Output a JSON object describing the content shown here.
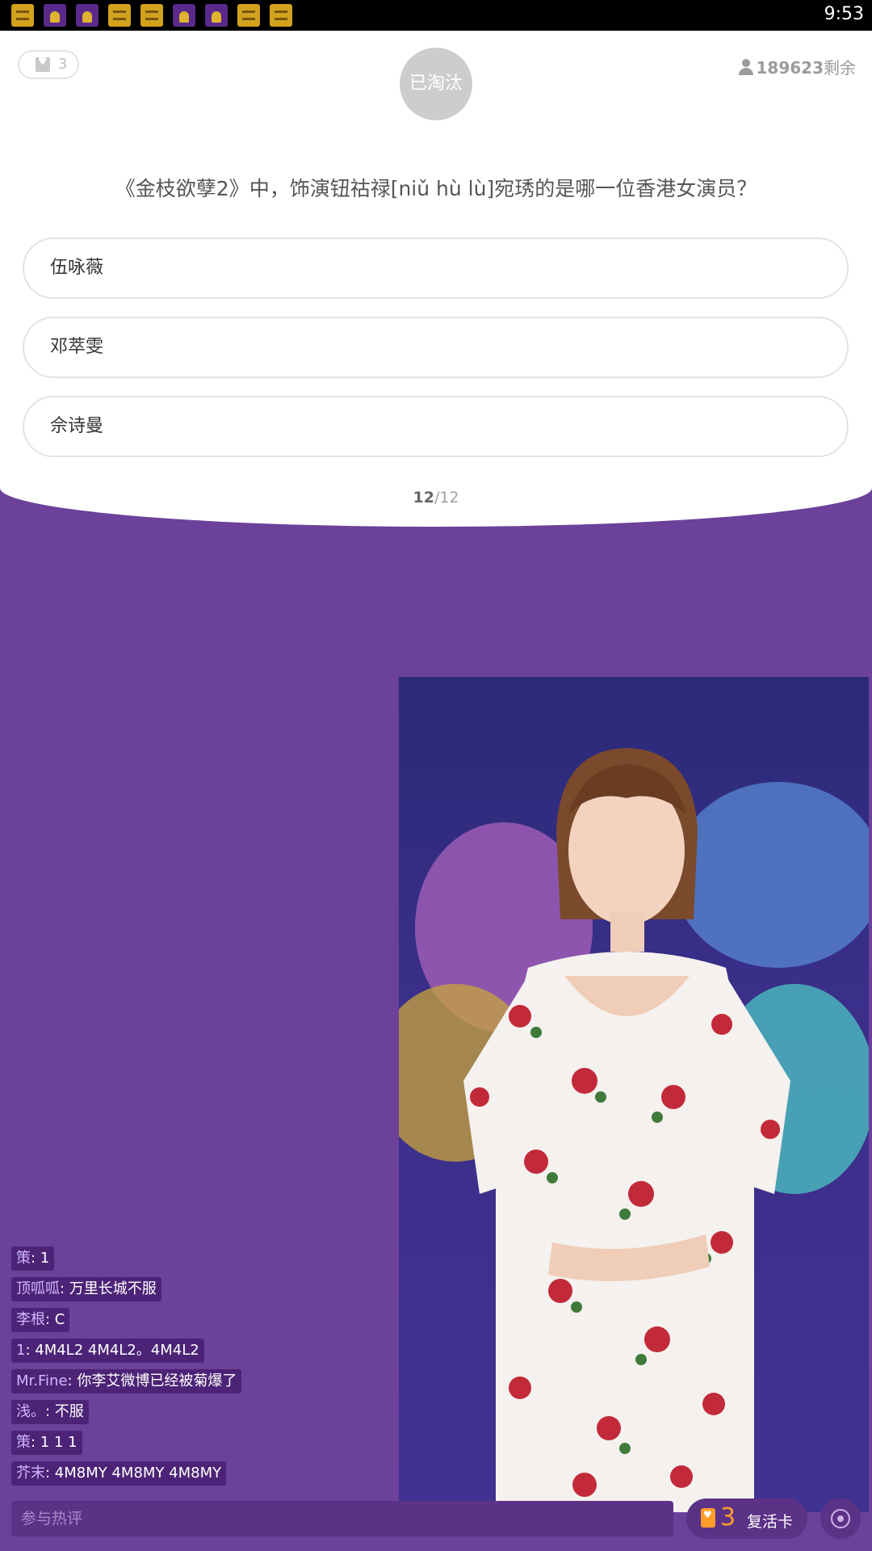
{
  "status_bar": {
    "time": "9:53",
    "notification_icons": [
      "gold-app-icon",
      "purple-app-icon",
      "purple-app-icon",
      "gold-app-icon",
      "gold-app-icon",
      "purple-app-icon",
      "purple-app-icon",
      "gold-app-icon",
      "gold-app-icon"
    ]
  },
  "header": {
    "lives_count": "3",
    "eliminated_label": "已淘汰",
    "remaining_count": "189623",
    "remaining_suffix": "剩余"
  },
  "question": {
    "text": "《金枝欲孽2》中，饰演钮祜禄[niǔ hù lù]宛琇的是哪一位香港女演员？",
    "options": [
      "伍咏薇",
      "邓萃雯",
      "佘诗曼"
    ],
    "progress_current": "12",
    "progress_total": "/12"
  },
  "comments": [
    {
      "user": "策",
      "text": ": 1"
    },
    {
      "user": "顶呱呱",
      "text": ": 万里长城不服"
    },
    {
      "user": "李根",
      "text": ": C"
    },
    {
      "user": "1",
      "text": ": 4M4L2 4M4L2。4M4L2"
    },
    {
      "user": "Mr.Fine",
      "text": ": 你李艾微博已经被菊爆了"
    },
    {
      "user": "浅。",
      "text": ": 不服"
    },
    {
      "user": "策",
      "text": ": 1 1 1"
    },
    {
      "user": "芥末",
      "text": ": 4M8MY 4M8MY 4M8MY"
    }
  ],
  "bottom_bar": {
    "comment_placeholder": "参与热评",
    "revive_count": "3",
    "revive_label": "复活卡"
  },
  "colors": {
    "background_purple": "#6b4199",
    "revive_orange": "#ff9d2b",
    "eliminated_grey": "#cdcdcd"
  }
}
